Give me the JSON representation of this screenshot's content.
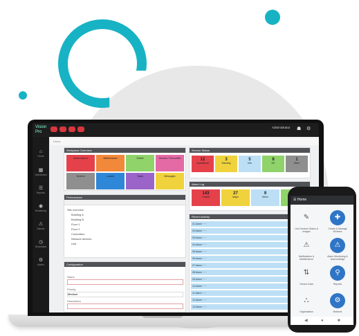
{
  "colors": {
    "accent": "#17b3c4",
    "dark": "#1d1d1d",
    "red": "#d9363e",
    "blue": "#2f75c6",
    "row_bg": "#bcdff5"
  },
  "topbar": {
    "logo": "Vision Pro",
    "user": "Administrator",
    "pills": [
      "•",
      "•",
      "•",
      "•"
    ]
  },
  "sidebar": {
    "items": [
      "Home",
      "Dashboard",
      "Reports",
      "Monitoring",
      "Alarms",
      "Schedules",
      "Admin"
    ]
  },
  "breadcrumb": "Home",
  "panels": {
    "p1": {
      "title": "Workplace Overview"
    },
    "p2": {
      "title": "Service Status"
    },
    "p3": {
      "title": "Performance"
    },
    "p4": {
      "title": "Configuration"
    },
    "p5": {
      "title": "Alarm Log"
    },
    "p6": {
      "title": "Recent Activity"
    }
  },
  "tiles1": [
    {
      "label": "Active Alarms",
      "value": "",
      "color": "#e5414b"
    },
    {
      "label": "Maintenance",
      "value": "",
      "color": "#f2883a"
    },
    {
      "label": "Online",
      "value": "",
      "color": "#8fd36a"
    },
    {
      "label": "Devices / Favourites",
      "value": "",
      "color": "#e46aa6"
    },
    {
      "label": "Servers",
      "value": "",
      "color": "#8f8f8f"
    },
    {
      "label": "Locked",
      "value": "",
      "color": "#2f87d8"
    },
    {
      "label": "Tasks",
      "value": "",
      "color": "#9a64c9"
    },
    {
      "label": "Messages",
      "value": "",
      "color": "#f0d23d"
    }
  ],
  "tiles2": [
    {
      "label": "Operational",
      "value": "12",
      "color": "#e5414b"
    },
    {
      "label": "Warning",
      "value": "3",
      "color": "#f0d23d"
    },
    {
      "label": "Info",
      "value": "5",
      "color": "#bcdff5"
    },
    {
      "label": "OK",
      "value": "8",
      "color": "#8fd36a"
    },
    {
      "label": "Other",
      "value": "1",
      "color": "#8f8f8f"
    }
  ],
  "tiles3": [
    {
      "label": "Critical",
      "value": "143",
      "color": "#e5414b"
    },
    {
      "label": "Major",
      "value": "27",
      "color": "#f0d23d"
    },
    {
      "label": "Minor",
      "value": "9",
      "color": "#bcdff5"
    },
    {
      "label": "Clear",
      "value": "56",
      "color": "#8fd36a"
    }
  ],
  "tree": [
    "Site overview",
    "Building A",
    "Building B",
    "Floor 1",
    "Floor 2",
    "Controllers",
    "Network devices",
    "Unit"
  ],
  "alarm_rows": [
    "01 Alarm ·····",
    "02 Alarm ·····",
    "03 Alarm ·····",
    "04 Alarm ·····",
    "05 Alarm ·····",
    "06 Alarm ·····",
    "07 Alarm ·····",
    "08 Alarm ·····",
    "09 Alarm ·····",
    "10 Alarm ·····",
    "11 Alarm ·····",
    "12 Alarm ·····",
    "13 Alarm ·····"
  ],
  "form": {
    "field1": "Name",
    "field2": "Priority",
    "field3": "Description",
    "value2": "Medium"
  },
  "phone": {
    "title": "Home",
    "items": [
      {
        "label": "Live Devices Status & Images",
        "icon": "✎"
      },
      {
        "label": "Create & Manage Workers",
        "icon": "✚"
      },
      {
        "label": "Notifications & Maintenance",
        "icon": "⚠"
      },
      {
        "label": "Alarm Monitoring & Acknowledge",
        "icon": "⚠"
      },
      {
        "label": "Device Data",
        "icon": "⇅"
      },
      {
        "label": "Reports",
        "icon": "⚲"
      },
      {
        "label": "Organisation",
        "icon": "⛬"
      },
      {
        "label": "Network",
        "icon": "⚙"
      }
    ],
    "nav": [
      "◀",
      "●",
      "■"
    ]
  }
}
